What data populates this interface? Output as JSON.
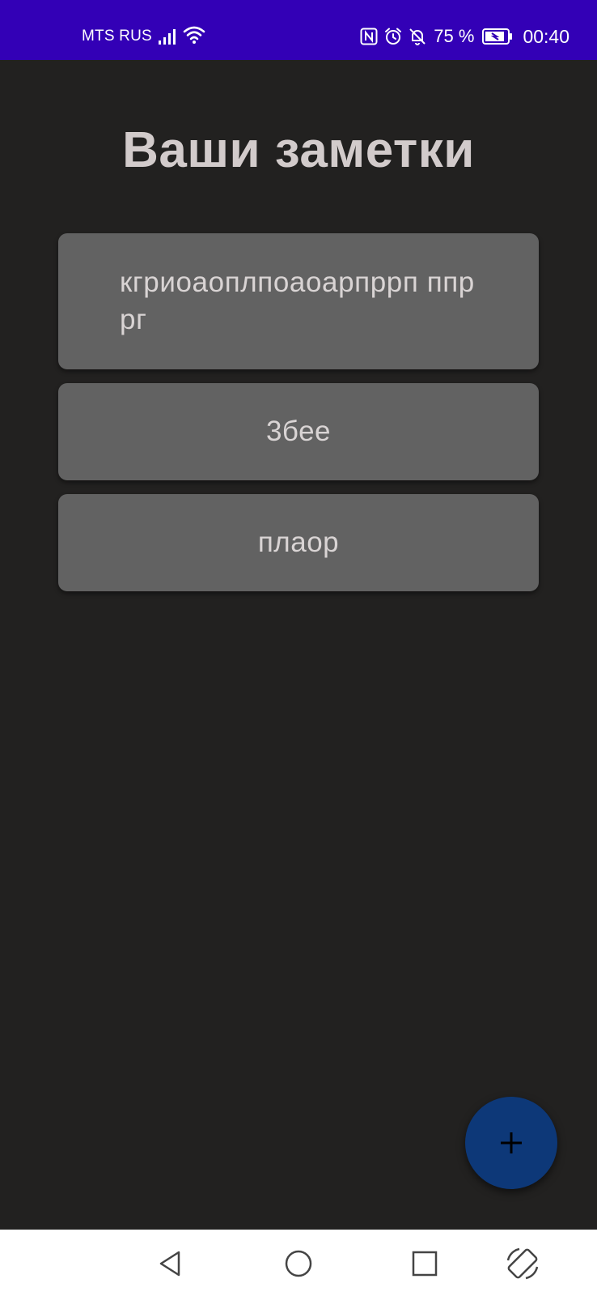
{
  "status_bar": {
    "carrier": "MTS RUS",
    "battery_percent": "75 %",
    "time": "00:40",
    "icons": [
      "signal-icon",
      "wifi-icon",
      "nfc-icon",
      "alarm-icon",
      "bell-off-icon",
      "battery-charging-icon"
    ],
    "background_color": "#3300b6"
  },
  "main": {
    "title": "Ваши заметки",
    "notes": [
      {
        "text": "кгриоаоплпоаоарпррп ппррг"
      },
      {
        "text": "3бее"
      },
      {
        "text": "плаор"
      }
    ]
  },
  "fab": {
    "icon": "plus-icon",
    "color": "#0d3878"
  },
  "nav_bar": {
    "icons": [
      "back-icon",
      "home-icon",
      "recent-apps-icon",
      "rotate-screen-icon"
    ]
  },
  "colors": {
    "background": "#222120",
    "card": "#626262",
    "title_text": "#d2cbcb"
  }
}
